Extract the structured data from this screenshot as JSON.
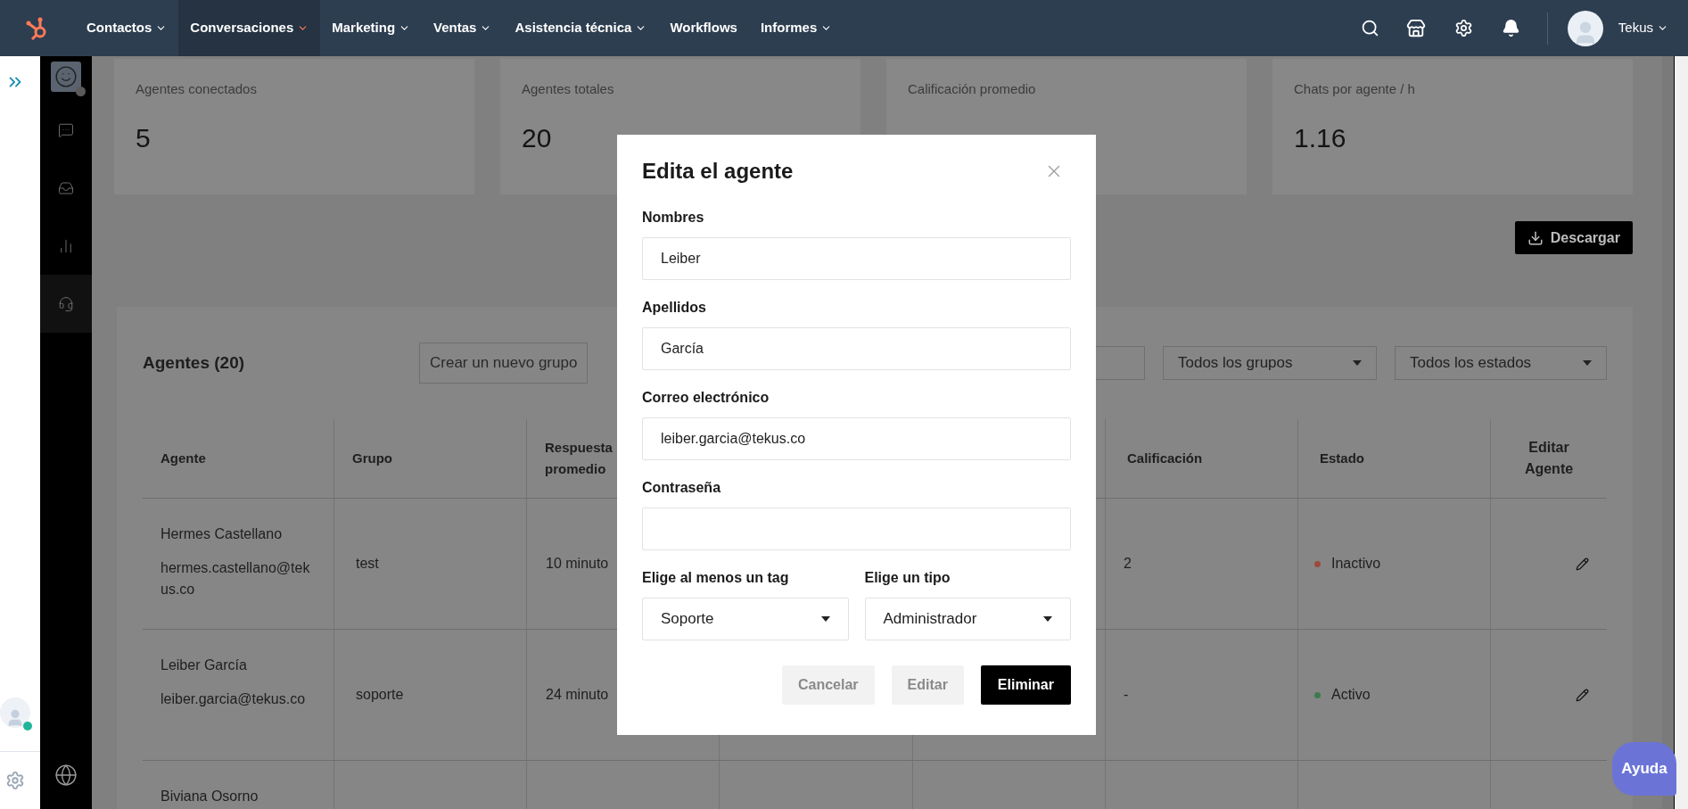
{
  "nav": {
    "items": [
      {
        "label": "Contactos",
        "caret": true,
        "selected": false
      },
      {
        "label": "Conversaciones",
        "caret": true,
        "selected": true
      },
      {
        "label": "Marketing",
        "caret": true,
        "selected": false
      },
      {
        "label": "Ventas",
        "caret": true,
        "selected": false
      },
      {
        "label": "Asistencia técnica",
        "caret": true,
        "selected": false
      },
      {
        "label": "Workflows",
        "caret": false,
        "selected": false
      },
      {
        "label": "Informes",
        "caret": true,
        "selected": false
      }
    ],
    "user_name": "Tekus"
  },
  "sidebar": {
    "items": [
      {
        "kind": "chat",
        "selected": false
      },
      {
        "kind": "inbox",
        "selected": false
      },
      {
        "kind": "chart",
        "selected": false
      },
      {
        "kind": "headset",
        "selected": true
      }
    ]
  },
  "stats": [
    {
      "label": "Agentes conectados",
      "value": "5"
    },
    {
      "label": "Agentes totales",
      "value": "20"
    },
    {
      "label": "Calificación promedio"
    },
    {
      "label": "Chats por agente / h",
      "value": "1.16"
    }
  ],
  "download_button": "Descargar",
  "agents_panel": {
    "title": "Agentes (20)",
    "create_group_button": "Crear un nuevo grupo",
    "group_filter": "Todos los grupos",
    "status_filter": "Todos los estados"
  },
  "table": {
    "columns": [
      "Agente",
      "Grupo",
      "Respuesta promedio",
      "Calificación",
      "Estado",
      "Editar Agente"
    ],
    "rows": [
      {
        "name": "Hermes Castellano",
        "email": "hermes.castellano@tekus.co",
        "group": "test",
        "response": "10 minuto",
        "rating": "2",
        "status": {
          "label": "Inactivo",
          "color": "#9c4a3e"
        }
      },
      {
        "name": "Leiber García",
        "email": "leiber.garcia@tekus.co",
        "group": "soporte",
        "response": "24 minuto",
        "rating": "-",
        "status": {
          "label": "Activo",
          "color": "#3d7a4c"
        }
      },
      {
        "name": "Biviana Osorno"
      }
    ]
  },
  "modal": {
    "title": "Edita el agente",
    "fields": [
      {
        "label": "Nombres",
        "value": "Leiber"
      },
      {
        "label": "Apellidos",
        "value": "García"
      },
      {
        "label": "Correo electrónico",
        "value": "leiber.garcia@tekus.co"
      },
      {
        "label": "Contraseña"
      }
    ],
    "selects": [
      {
        "label": "Elige al menos un tag",
        "value": "Soporte"
      },
      {
        "label": "Elige un tipo",
        "value": "Administrador"
      }
    ],
    "buttons": [
      {
        "label": "Cancelar",
        "kind": "secondary"
      },
      {
        "label": "Editar",
        "kind": "secondary"
      },
      {
        "label": "Eliminar",
        "kind": "primary"
      }
    ]
  },
  "help_button": "Ayuda"
}
